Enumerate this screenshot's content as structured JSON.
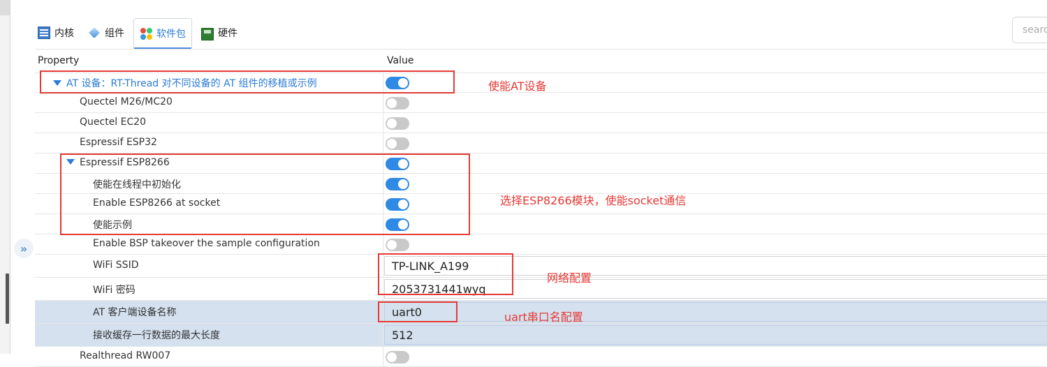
{
  "tabs": [
    {
      "label": "内核",
      "icon": "kernel-icon"
    },
    {
      "label": "组件",
      "icon": "component-icon"
    },
    {
      "label": "软件包",
      "icon": "package-icon",
      "active": true
    },
    {
      "label": "硬件",
      "icon": "hardware-icon"
    }
  ],
  "search": {
    "placeholder": "searc"
  },
  "grid": {
    "property_header": "Property",
    "value_header": "Value"
  },
  "rows": [
    {
      "label": "AT 设备：RT-Thread 对不同设备的 AT 组件的移植或示例",
      "type": "toggle",
      "on": true,
      "expanded": true
    },
    {
      "label": "Quectel M26/MC20",
      "type": "toggle",
      "on": false
    },
    {
      "label": "Quectel EC20",
      "type": "toggle",
      "on": false
    },
    {
      "label": "Espressif ESP32",
      "type": "toggle",
      "on": false
    },
    {
      "label": "Espressif ESP8266",
      "type": "toggle",
      "on": true,
      "expanded": true
    },
    {
      "label": "使能在线程中初始化",
      "type": "toggle",
      "on": true
    },
    {
      "label": "Enable ESP8266 at socket",
      "type": "toggle",
      "on": true
    },
    {
      "label": "使能示例",
      "type": "toggle",
      "on": true
    },
    {
      "label": "Enable BSP takeover the sample configuration",
      "type": "toggle",
      "on": false
    },
    {
      "label": "WiFi SSID",
      "type": "text",
      "value": "TP-LINK_A199"
    },
    {
      "label": "WiFi 密码",
      "type": "text",
      "value": "2053731441wyq"
    },
    {
      "label": "AT 客户端设备名称",
      "type": "text",
      "value": "uart0",
      "selected": true
    },
    {
      "label": "接收缓存一行数据的最大长度",
      "type": "text",
      "value": "512",
      "selected": true
    },
    {
      "label": "Realthread RW007",
      "type": "toggle",
      "on": false
    }
  ],
  "annotations": {
    "at_device": "使能AT设备",
    "esp8266": "选择ESP8266模块，使能socket通信",
    "network": "网络配置",
    "uart": "uart串口名配置"
  },
  "colors": {
    "accent": "#2f8ae5",
    "annotation_red": "#e53935",
    "selected_row": "#d5e1ef"
  }
}
